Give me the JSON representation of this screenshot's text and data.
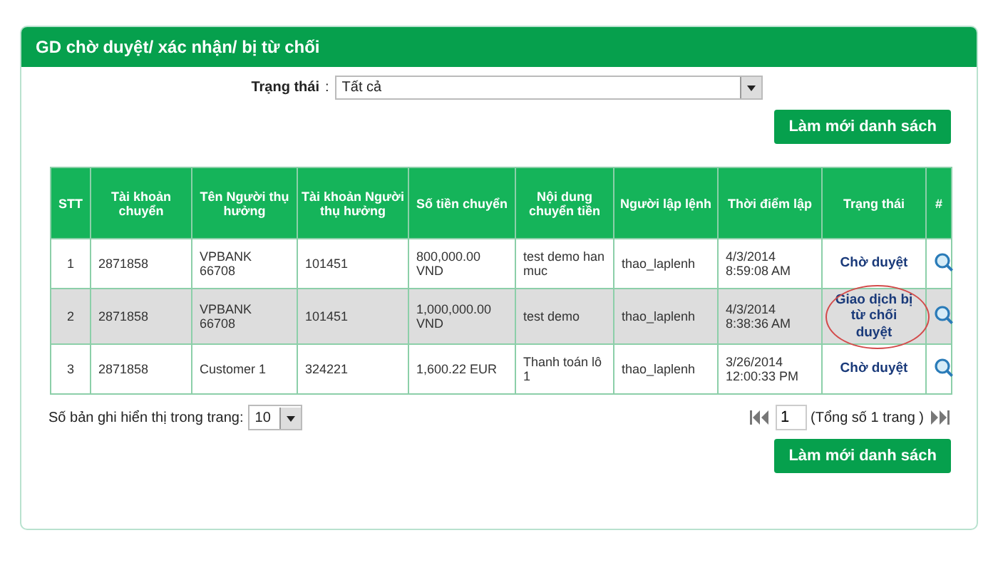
{
  "panel": {
    "title": "GD chờ duyệt/ xác nhận/ bị từ chối"
  },
  "filter": {
    "label": "Trạng thái",
    "separator": ":",
    "value": "Tất cả"
  },
  "refresh_button": "Làm mới danh sách",
  "table": {
    "columns": [
      "STT",
      "Tài khoản chuyển",
      "Tên Người thụ hưởng",
      "Tài khoản Người thụ hưởng",
      "Số tiền chuyển",
      "Nội dung chuyển tiền",
      "Người lập lệnh",
      "Thời điểm lập",
      "Trạng thái",
      "#"
    ],
    "rows": [
      {
        "cells": [
          "1",
          "2871858",
          "VPBANK 66708",
          "101451",
          "800,000.00 VND",
          "test demo han muc",
          "thao_laplenh",
          "4/3/2014 8:59:08 AM",
          "Chờ duyệt"
        ],
        "circled": false
      },
      {
        "cells": [
          "2",
          "2871858",
          "VPBANK 66708",
          "101451",
          "1,000,000.00 VND",
          "test demo",
          "thao_laplenh",
          "4/3/2014 8:38:36 AM",
          "Giao dịch bị từ chối duyệt"
        ],
        "circled": true
      },
      {
        "cells": [
          "3",
          "2871858",
          "Customer 1",
          "324221",
          "1,600.22 EUR",
          "Thanh toán lô 1",
          "thao_laplenh",
          "3/26/2014 12:00:33 PM",
          "Chờ duyệt"
        ],
        "circled": false
      }
    ]
  },
  "page_size": {
    "label": "Số bản ghi hiển thị trong trang:",
    "value": "10"
  },
  "pager": {
    "page": "1",
    "total": "(Tổng số 1 trang )"
  },
  "bottom_button": "Làm mới danh sách"
}
